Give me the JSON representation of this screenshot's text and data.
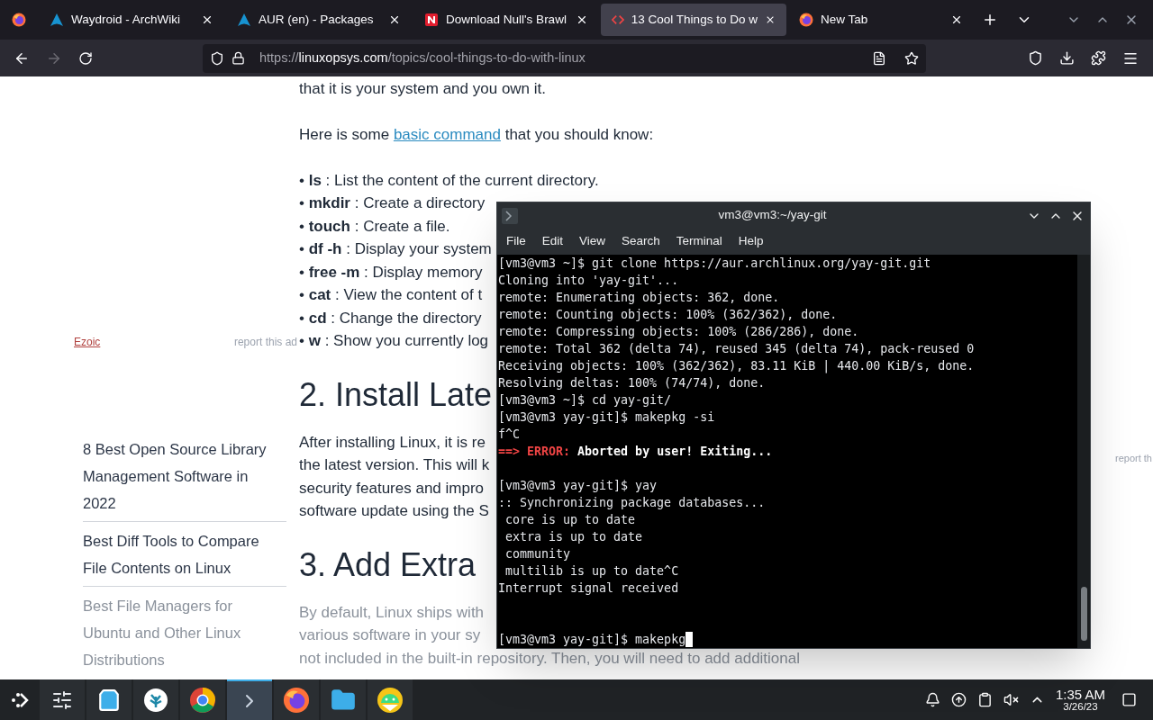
{
  "browser": {
    "tabs": [
      {
        "kind": "arch",
        "title": "Waydroid - ArchWiki",
        "selected": false
      },
      {
        "kind": "arch",
        "title": "AUR (en) - Packages",
        "selected": false
      },
      {
        "kind": "news",
        "title": "Download Null's Brawl",
        "selected": false
      },
      {
        "kind": "code",
        "title": "13 Cool Things to Do w",
        "selected": true
      },
      {
        "kind": "firefox",
        "title": "New Tab",
        "selected": false
      }
    ],
    "address": {
      "scheme": "https://",
      "domain": "linuxopsys.com",
      "path": "/topics/cool-things-to-do-with-linux"
    },
    "forward_disabled": true
  },
  "page": {
    "ad": {
      "label": "Ezoic",
      "report": "report this ad"
    },
    "sidebar": [
      {
        "lines": [
          "8 Best Open Source Library",
          "Management Software in",
          "2022"
        ],
        "faded": false
      },
      {
        "lines": [
          "Best Diff Tools to Compare",
          "File Contents on Linux"
        ],
        "faded": false
      },
      {
        "lines": [
          "Best File Managers for",
          "Ubuntu and Other Linux",
          "Distributions"
        ],
        "faded": true
      }
    ],
    "intro": "that it is your system and you own it.",
    "lead": {
      "before": "Here is some",
      "link": "basic command",
      "after": "that you should know:"
    },
    "bullets": [
      "• **ls** : List the content of the current directory.",
      "• **mkdir** : Create a directory",
      "• **touch** : Create a file.",
      "• **df -h** : Display your system",
      "• **free -m** : Display memory",
      "• **cat** : View the content of t",
      "• **cd** : Change the directory",
      "• **w** : Show you currently log"
    ],
    "sections": [
      {
        "heading": "2. Install Late",
        "lines": [
          "After installing Linux, it is re",
          "the latest version. This will k",
          "security features and impro",
          "software update using the S"
        ],
        "faded": false
      },
      {
        "heading": "3. Add Extra",
        "lines": [
          "By default, Linux ships with",
          "various software in your sy",
          "not included in the built-in repository. Then, you will need to add additional"
        ],
        "faded": true
      }
    ],
    "right_report": "report th"
  },
  "terminal": {
    "title": "vm3@vm3:~/yay-git",
    "menu": [
      "File",
      "Edit",
      "View",
      "Search",
      "Terminal",
      "Help"
    ],
    "lines": [
      {
        "kind": "text",
        "text": "[vm3@vm3 ~]$ git clone https://aur.archlinux.org/yay-git.git"
      },
      {
        "kind": "text",
        "text": "Cloning into 'yay-git'..."
      },
      {
        "kind": "text",
        "text": "remote: Enumerating objects: 362, done."
      },
      {
        "kind": "text",
        "text": "remote: Counting objects: 100% (362/362), done."
      },
      {
        "kind": "text",
        "text": "remote: Compressing objects: 100% (286/286), done."
      },
      {
        "kind": "text",
        "text": "remote: Total 362 (delta 74), reused 345 (delta 74), pack-reused 0"
      },
      {
        "kind": "text",
        "text": "Receiving objects: 100% (362/362), 83.11 KiB | 440.00 KiB/s, done."
      },
      {
        "kind": "text",
        "text": "Resolving deltas: 100% (74/74), done."
      },
      {
        "kind": "text",
        "text": "[vm3@vm3 ~]$ cd yay-git/"
      },
      {
        "kind": "text",
        "text": "[vm3@vm3 yay-git]$ makepkg -si"
      },
      {
        "kind": "text",
        "text": "f^C"
      },
      {
        "kind": "error",
        "prefix": "==> ERROR:",
        "text": "Aborted by user! Exiting..."
      },
      {
        "kind": "blank"
      },
      {
        "kind": "text",
        "text": "[vm3@vm3 yay-git]$ yay"
      },
      {
        "kind": "text",
        "text": ":: Synchronizing package databases..."
      },
      {
        "kind": "text",
        "text": " core is up to date"
      },
      {
        "kind": "text",
        "text": " extra is up to date"
      },
      {
        "kind": "text",
        "text": " community"
      },
      {
        "kind": "text",
        "text": " multilib is up to date^C"
      },
      {
        "kind": "text",
        "text": "Interrupt signal received"
      },
      {
        "kind": "blank"
      },
      {
        "kind": "blank"
      },
      {
        "kind": "cursor",
        "text": "[vm3@vm3 yay-git]$ makepkg"
      }
    ]
  },
  "taskbar": {
    "apps": [
      {
        "kind": "settings",
        "selected": false
      },
      {
        "kind": "store",
        "selected": false
      },
      {
        "kind": "app",
        "selected": false
      },
      {
        "kind": "chrome",
        "selected": false
      },
      {
        "kind": "terminal",
        "selected": true
      },
      {
        "kind": "firefox",
        "selected": false
      },
      {
        "kind": "files",
        "selected": false
      },
      {
        "kind": "android",
        "selected": false
      }
    ],
    "time": "1:35 AM",
    "date": "3/26/23"
  }
}
